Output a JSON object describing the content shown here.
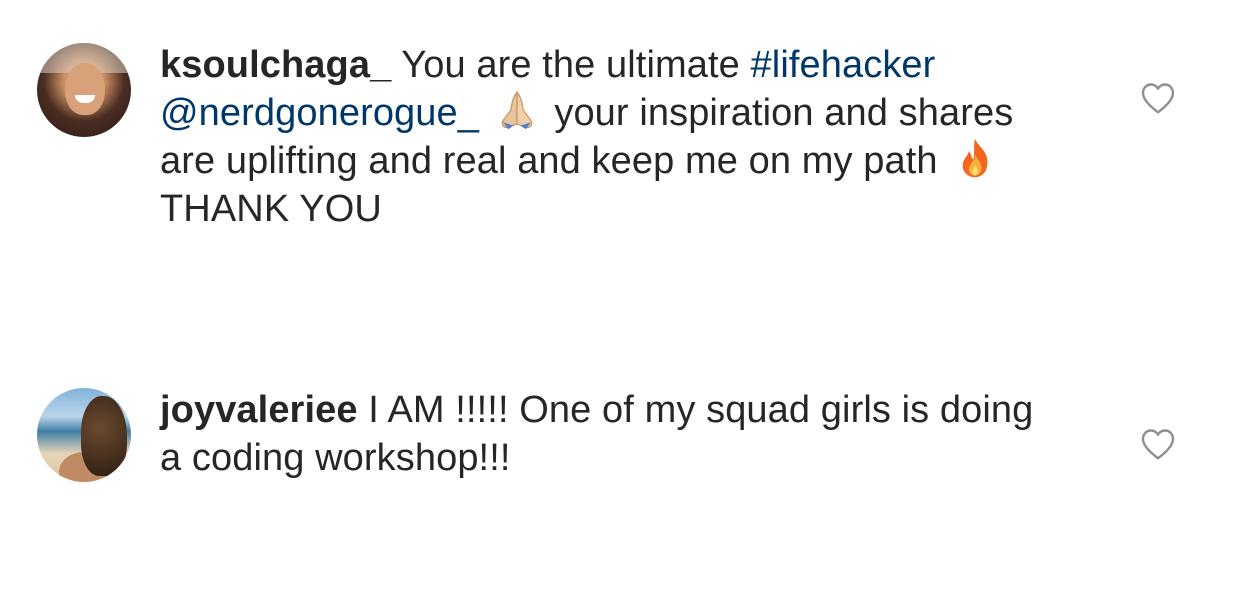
{
  "comments": [
    {
      "username": "ksoulchaga_",
      "text_1": " You are the ultimate ",
      "hashtag": "#lifehacker",
      "mention": "@nerdgonerogue_",
      "text_2": " your inspiration and shares are uplifting and real and keep me on my path ",
      "text_3": " THANK YOU",
      "emoji_1": "folded-hands-icon",
      "emoji_2": "fire-icon",
      "liked": false
    },
    {
      "username": "joyvaleriee",
      "text_1": " I AM !!!!! One of my squad girls is doing a coding workshop!!!",
      "liked": false
    }
  ],
  "icons": {
    "like": "heart-outline-icon"
  },
  "colors": {
    "text": "#262626",
    "link": "#00376b",
    "icon": "#8e8e8e"
  }
}
